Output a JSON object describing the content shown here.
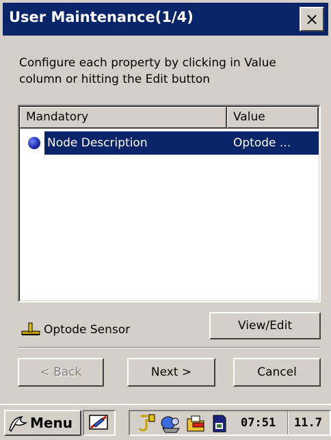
{
  "window": {
    "title": "User Maintenance(1/4)",
    "close_label": "×"
  },
  "instructions": "Configure each property by clicking in Value column or hitting the Edit button",
  "list": {
    "columns": [
      "Mandatory",
      "Value"
    ],
    "rows": [
      {
        "icon": "blue-bullet-icon",
        "name": "Node Description",
        "value": "Optode ..."
      }
    ]
  },
  "device": {
    "icon": "sensor-device-icon",
    "label": "Optode Sensor"
  },
  "buttons": {
    "view_edit": "View/Edit",
    "back": "< Back",
    "next": "Next >",
    "cancel": "Cancel"
  },
  "taskbar": {
    "menu_label": "Menu",
    "time": "07:51",
    "extra": "11.7",
    "icons": [
      "start-flag-icon",
      "no-pen-icon",
      "cable-icon",
      "network-icon",
      "folder-icon",
      "sd-card-icon"
    ]
  },
  "colors": {
    "titlebar": "#0a2469",
    "selection": "#0a2469",
    "face": "#d4d0c8"
  }
}
